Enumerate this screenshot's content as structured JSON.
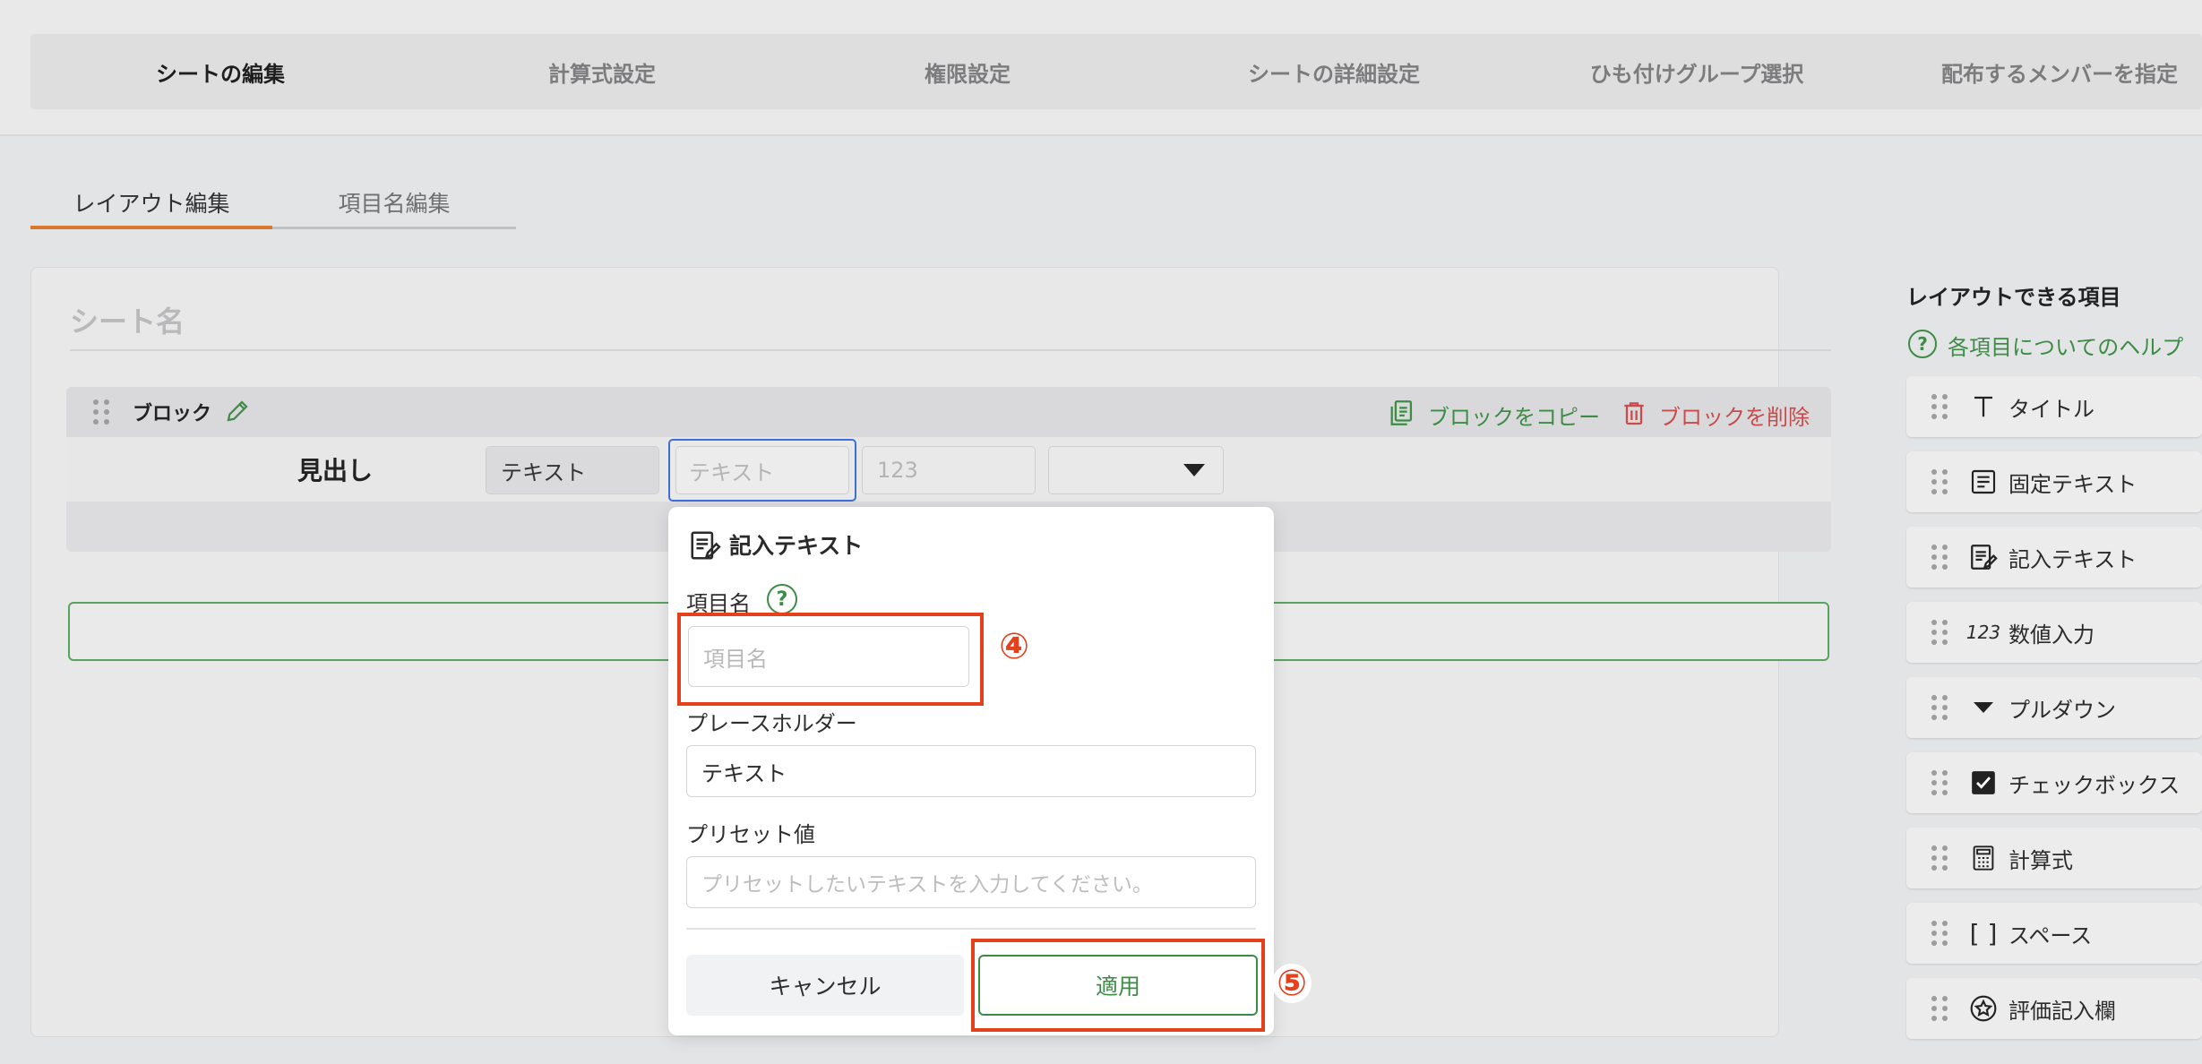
{
  "steps": [
    {
      "label": "シートの編集"
    },
    {
      "label": "計算式設定"
    },
    {
      "label": "権限設定"
    },
    {
      "label": "シートの詳細設定"
    },
    {
      "label": "ひも付けグループ選択"
    },
    {
      "label": "配布するメンバーを指定"
    }
  ],
  "subtabs": {
    "layout": "レイアウト編集",
    "item_name": "項目名編集"
  },
  "sheet": {
    "name_placeholder": "シート名"
  },
  "block": {
    "title": "ブロック",
    "copy_label": "ブロックをコピー",
    "delete_label": "ブロックを削除",
    "row": {
      "heading": "見出し",
      "text_cell": "テキスト",
      "input_placeholder": "テキスト",
      "number_placeholder": "123"
    }
  },
  "popover": {
    "title": "記入テキスト",
    "item_name_label": "項目名",
    "item_name_placeholder": "項目名",
    "placeholder_label": "プレースホルダー",
    "placeholder_value": "テキスト",
    "preset_label": "プリセット値",
    "preset_placeholder": "プリセットしたいテキストを入力してください。",
    "cancel_label": "キャンセル",
    "apply_label": "適用",
    "marker_4": "④",
    "marker_5": "⑤"
  },
  "sidebar": {
    "title": "レイアウトできる項目",
    "help_label": "各項目についてのヘルプ",
    "items": [
      {
        "label": "タイトル",
        "icon": "title-icon"
      },
      {
        "label": "固定テキスト",
        "icon": "fixed-text-icon"
      },
      {
        "label": "記入テキスト",
        "icon": "input-text-icon"
      },
      {
        "label": "数値入力",
        "icon": "number-icon",
        "glyph": "123"
      },
      {
        "label": "プルダウン",
        "icon": "dropdown-icon"
      },
      {
        "label": "チェックボックス",
        "icon": "checkbox-icon"
      },
      {
        "label": "計算式",
        "icon": "calculator-icon"
      },
      {
        "label": "スペース",
        "icon": "space-icon",
        "glyph": "[ ]"
      },
      {
        "label": "評価記入欄",
        "icon": "rating-icon"
      }
    ]
  },
  "colors": {
    "accent_green": "#3d8c45",
    "delete_red": "#c94b4b",
    "tab_underline": "#d9772f",
    "annotation_red": "#e4401c",
    "focus_blue": "#3e6fd8"
  }
}
